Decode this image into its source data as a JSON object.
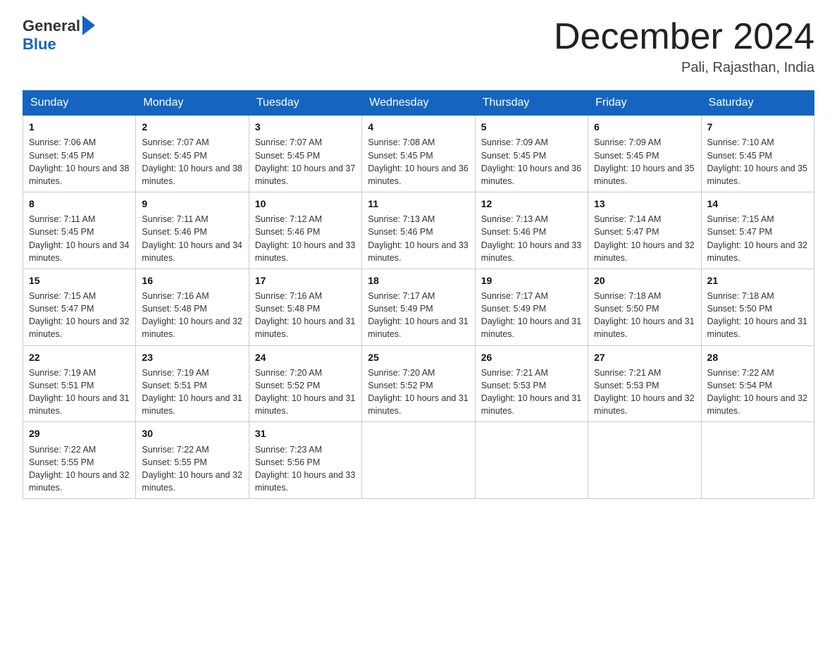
{
  "header": {
    "logo_general": "General",
    "logo_blue": "Blue",
    "month_title": "December 2024",
    "location": "Pali, Rajasthan, India"
  },
  "days_of_week": [
    "Sunday",
    "Monday",
    "Tuesday",
    "Wednesday",
    "Thursday",
    "Friday",
    "Saturday"
  ],
  "weeks": [
    [
      {
        "day": "1",
        "sunrise": "7:06 AM",
        "sunset": "5:45 PM",
        "daylight": "10 hours and 38 minutes."
      },
      {
        "day": "2",
        "sunrise": "7:07 AM",
        "sunset": "5:45 PM",
        "daylight": "10 hours and 38 minutes."
      },
      {
        "day": "3",
        "sunrise": "7:07 AM",
        "sunset": "5:45 PM",
        "daylight": "10 hours and 37 minutes."
      },
      {
        "day": "4",
        "sunrise": "7:08 AM",
        "sunset": "5:45 PM",
        "daylight": "10 hours and 36 minutes."
      },
      {
        "day": "5",
        "sunrise": "7:09 AM",
        "sunset": "5:45 PM",
        "daylight": "10 hours and 36 minutes."
      },
      {
        "day": "6",
        "sunrise": "7:09 AM",
        "sunset": "5:45 PM",
        "daylight": "10 hours and 35 minutes."
      },
      {
        "day": "7",
        "sunrise": "7:10 AM",
        "sunset": "5:45 PM",
        "daylight": "10 hours and 35 minutes."
      }
    ],
    [
      {
        "day": "8",
        "sunrise": "7:11 AM",
        "sunset": "5:45 PM",
        "daylight": "10 hours and 34 minutes."
      },
      {
        "day": "9",
        "sunrise": "7:11 AM",
        "sunset": "5:46 PM",
        "daylight": "10 hours and 34 minutes."
      },
      {
        "day": "10",
        "sunrise": "7:12 AM",
        "sunset": "5:46 PM",
        "daylight": "10 hours and 33 minutes."
      },
      {
        "day": "11",
        "sunrise": "7:13 AM",
        "sunset": "5:46 PM",
        "daylight": "10 hours and 33 minutes."
      },
      {
        "day": "12",
        "sunrise": "7:13 AM",
        "sunset": "5:46 PM",
        "daylight": "10 hours and 33 minutes."
      },
      {
        "day": "13",
        "sunrise": "7:14 AM",
        "sunset": "5:47 PM",
        "daylight": "10 hours and 32 minutes."
      },
      {
        "day": "14",
        "sunrise": "7:15 AM",
        "sunset": "5:47 PM",
        "daylight": "10 hours and 32 minutes."
      }
    ],
    [
      {
        "day": "15",
        "sunrise": "7:15 AM",
        "sunset": "5:47 PM",
        "daylight": "10 hours and 32 minutes."
      },
      {
        "day": "16",
        "sunrise": "7:16 AM",
        "sunset": "5:48 PM",
        "daylight": "10 hours and 32 minutes."
      },
      {
        "day": "17",
        "sunrise": "7:16 AM",
        "sunset": "5:48 PM",
        "daylight": "10 hours and 31 minutes."
      },
      {
        "day": "18",
        "sunrise": "7:17 AM",
        "sunset": "5:49 PM",
        "daylight": "10 hours and 31 minutes."
      },
      {
        "day": "19",
        "sunrise": "7:17 AM",
        "sunset": "5:49 PM",
        "daylight": "10 hours and 31 minutes."
      },
      {
        "day": "20",
        "sunrise": "7:18 AM",
        "sunset": "5:50 PM",
        "daylight": "10 hours and 31 minutes."
      },
      {
        "day": "21",
        "sunrise": "7:18 AM",
        "sunset": "5:50 PM",
        "daylight": "10 hours and 31 minutes."
      }
    ],
    [
      {
        "day": "22",
        "sunrise": "7:19 AM",
        "sunset": "5:51 PM",
        "daylight": "10 hours and 31 minutes."
      },
      {
        "day": "23",
        "sunrise": "7:19 AM",
        "sunset": "5:51 PM",
        "daylight": "10 hours and 31 minutes."
      },
      {
        "day": "24",
        "sunrise": "7:20 AM",
        "sunset": "5:52 PM",
        "daylight": "10 hours and 31 minutes."
      },
      {
        "day": "25",
        "sunrise": "7:20 AM",
        "sunset": "5:52 PM",
        "daylight": "10 hours and 31 minutes."
      },
      {
        "day": "26",
        "sunrise": "7:21 AM",
        "sunset": "5:53 PM",
        "daylight": "10 hours and 31 minutes."
      },
      {
        "day": "27",
        "sunrise": "7:21 AM",
        "sunset": "5:53 PM",
        "daylight": "10 hours and 32 minutes."
      },
      {
        "day": "28",
        "sunrise": "7:22 AM",
        "sunset": "5:54 PM",
        "daylight": "10 hours and 32 minutes."
      }
    ],
    [
      {
        "day": "29",
        "sunrise": "7:22 AM",
        "sunset": "5:55 PM",
        "daylight": "10 hours and 32 minutes."
      },
      {
        "day": "30",
        "sunrise": "7:22 AM",
        "sunset": "5:55 PM",
        "daylight": "10 hours and 32 minutes."
      },
      {
        "day": "31",
        "sunrise": "7:23 AM",
        "sunset": "5:56 PM",
        "daylight": "10 hours and 33 minutes."
      },
      null,
      null,
      null,
      null
    ]
  ]
}
